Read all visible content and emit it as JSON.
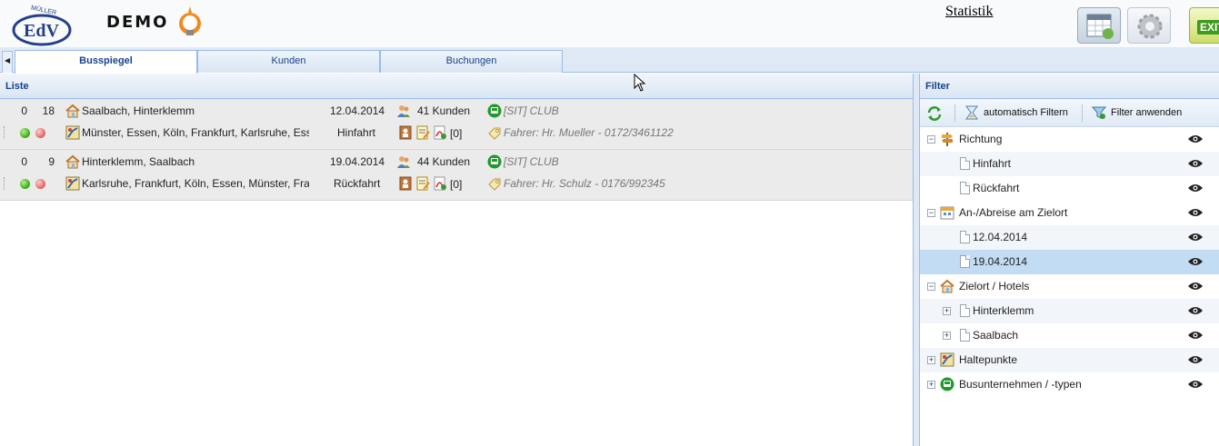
{
  "header": {
    "logo_text": "EdV",
    "logo_arc_text": "MÜLLER",
    "demo_label": "DEMO",
    "statistik_link": "Statistik",
    "exit_label": "EXIT",
    "icons": [
      "calendar-icon",
      "gear-icon",
      "exit-icon"
    ]
  },
  "tabs": [
    {
      "label": "Busspiegel",
      "active": true
    },
    {
      "label": "Kunden",
      "active": false
    },
    {
      "label": "Buchungen",
      "active": false
    }
  ],
  "list": {
    "title": "Liste",
    "rows": [
      {
        "col_a": "0",
        "col_b": "18",
        "destination": "Saalbach, Hinterklemm",
        "date": "12.04.2014",
        "customers": "41 Kunden",
        "bus": "[SIT] CLUB",
        "stops": "Münster, Essen, Köln, Frankfurt, Karlsruhe, Ess",
        "direction": "Hinfahrt",
        "attachments": "[0]",
        "driver": "Fahrer: Hr. Mueller - 0172/3461122"
      },
      {
        "col_a": "0",
        "col_b": "9",
        "destination": "Hinterklemm, Saalbach",
        "date": "19.04.2014",
        "customers": "44 Kunden",
        "bus": "[SIT] CLUB",
        "stops": "Karlsruhe, Frankfurt, Köln, Essen, Münster, Frai",
        "direction": "Rückfahrt",
        "attachments": "[0]",
        "driver": "Fahrer: Hr. Schulz - 0176/992345"
      }
    ]
  },
  "filter": {
    "title": "Filter",
    "toolbar": {
      "auto_filter": "automatisch Filtern",
      "apply_filter": "Filter anwenden"
    },
    "tree": [
      {
        "label": "Richtung",
        "level": 0,
        "expanded": true,
        "icon": "signpost-icon"
      },
      {
        "label": "Hinfahrt",
        "level": 1,
        "icon": "document-icon"
      },
      {
        "label": "Rückfahrt",
        "level": 1,
        "icon": "document-icon"
      },
      {
        "label": "An-/Abreise am Zielort",
        "level": 0,
        "expanded": true,
        "icon": "calendar-icon"
      },
      {
        "label": "12.04.2014",
        "level": 1,
        "icon": "document-icon"
      },
      {
        "label": "19.04.2014",
        "level": 1,
        "icon": "document-icon",
        "selected": true
      },
      {
        "label": "Zielort / Hotels",
        "level": 0,
        "expanded": true,
        "icon": "house-icon"
      },
      {
        "label": "Hinterklemm",
        "level": 1,
        "expandable": true,
        "icon": "document-icon"
      },
      {
        "label": "Saalbach",
        "level": 1,
        "expandable": true,
        "icon": "document-icon"
      },
      {
        "label": "Haltepunkte",
        "level": 0,
        "expanded": false,
        "icon": "map-icon"
      },
      {
        "label": "Busunternehmen / -typen",
        "level": 0,
        "expanded": false,
        "icon": "bus-icon"
      }
    ]
  },
  "colors": {
    "accent_blue": "#15428b",
    "border_blue": "#99bbe8",
    "selected_row": "#c2dcf4",
    "status_green": "#34a812",
    "status_red": "#e35c5c",
    "bus_green": "#1f9a2c"
  }
}
